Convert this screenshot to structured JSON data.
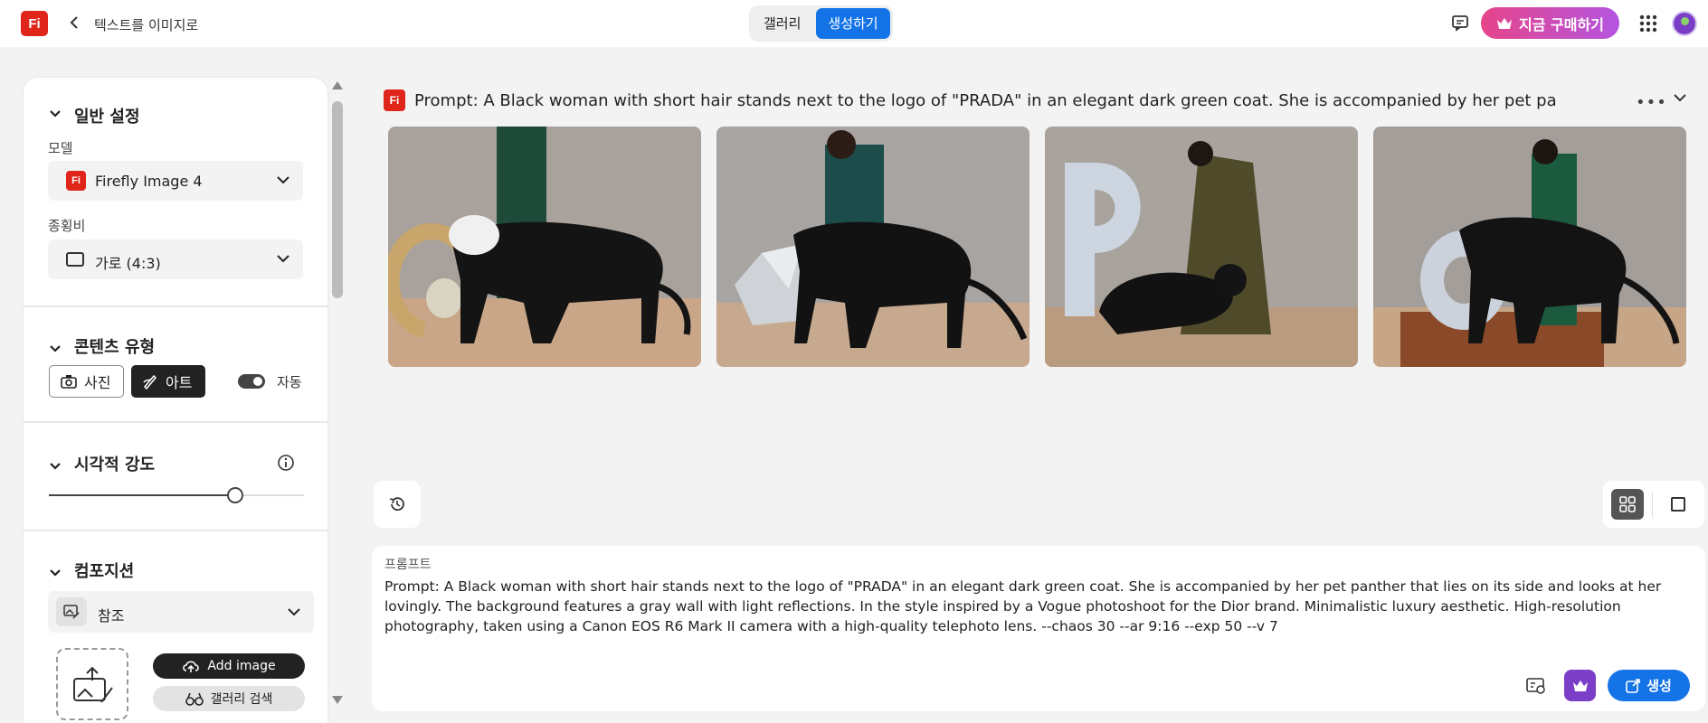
{
  "header": {
    "logo_text": "Fi",
    "breadcrumb": "텍스트를 이미지로",
    "tabs": [
      {
        "label": "갤러리",
        "active": false
      },
      {
        "label": "생성하기",
        "active": true
      }
    ],
    "buy_label": "지금 구매하기"
  },
  "sidebar": {
    "general": {
      "title": "일반 설정",
      "model_label": "모델",
      "model_value": "Firefly Image 4",
      "ratio_label": "종횡비",
      "ratio_value": "가로 (4:3)"
    },
    "content_type": {
      "title": "콘텐츠 유형",
      "photo_label": "사진",
      "art_label": "아트",
      "selected": "아트",
      "auto_label": "자동",
      "auto_on": true
    },
    "visual_intensity": {
      "title": "시각적 강도",
      "value": 0.73
    },
    "composition": {
      "title": "컴포지션",
      "ref_label": "참조",
      "add_image_label": "Add image",
      "gallery_search_label": "갤러리 검색"
    }
  },
  "main": {
    "prompt_header": "Prompt: A Black woman with short hair stands next to the logo of \"PRADA\" in an elegant dark green coat. She is accompanied by her pet panther that lies on its side and looks at her lovingly.",
    "images": [
      {
        "name": "image-1"
      },
      {
        "name": "image-2"
      },
      {
        "name": "image-3"
      },
      {
        "name": "image-4"
      }
    ],
    "prompt_box": {
      "label": "프롬프트",
      "text": "Prompt: A Black woman with short hair stands next to the logo of \"PRADA\" in an elegant dark green coat. She is accompanied by her pet panther that lies on its side and looks at her lovingly. The background features a gray wall with light reflections. In the style inspired by a Vogue photoshoot for the Dior brand. Minimalistic luxury aesthetic. High-resolution photography, taken using a Canon EOS R6 Mark II camera with a high-quality telephoto lens. --chaos 30 --ar 9:16 --exp 50 --v 7",
      "generate_label": "생성"
    }
  },
  "colors": {
    "accent": "#1473e6",
    "brand_red": "#e0251b",
    "premium_purple": "#7b3fc7"
  }
}
